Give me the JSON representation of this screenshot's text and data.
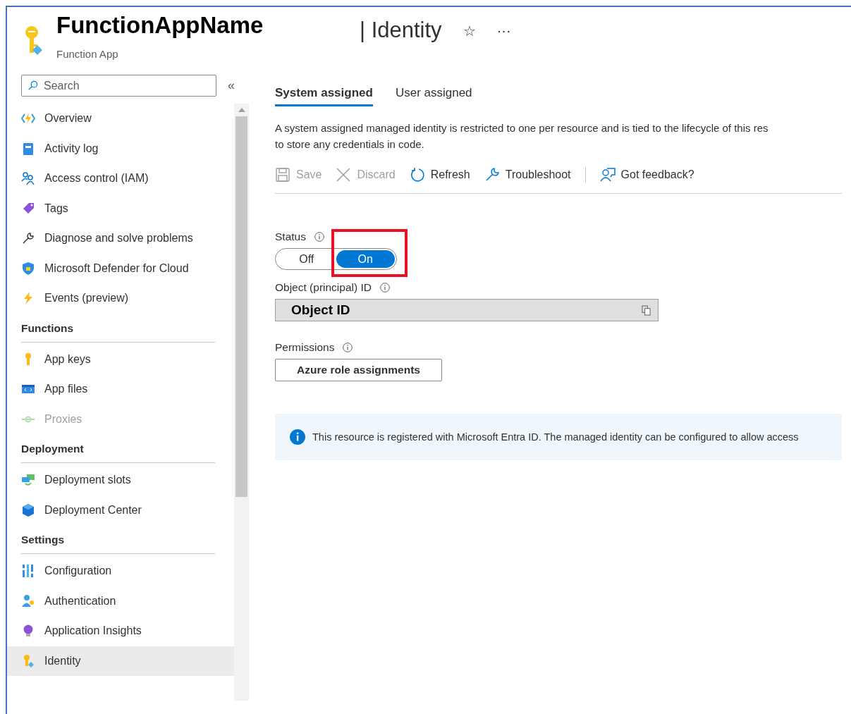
{
  "header": {
    "title": "FunctionAppName",
    "subtitle": "Function App",
    "page": "| Identity",
    "favorite": "☆",
    "more": "···"
  },
  "sidebar": {
    "search": {
      "placeholder": "Search"
    },
    "collapse": "«",
    "groups": [
      {
        "items": [
          {
            "label": "Overview",
            "disabled": false,
            "selected": false
          },
          {
            "label": "Activity log",
            "disabled": false,
            "selected": false
          },
          {
            "label": "Access control (IAM)",
            "disabled": false,
            "selected": false
          },
          {
            "label": "Tags",
            "disabled": false,
            "selected": false
          },
          {
            "label": "Diagnose and solve problems",
            "disabled": false,
            "selected": false
          },
          {
            "label": "Microsoft Defender for Cloud",
            "disabled": false,
            "selected": false
          },
          {
            "label": "Events (preview)",
            "disabled": false,
            "selected": false
          }
        ]
      },
      {
        "heading": "Functions",
        "items": [
          {
            "label": "App keys",
            "disabled": false,
            "selected": false
          },
          {
            "label": "App files",
            "disabled": false,
            "selected": false
          },
          {
            "label": "Proxies",
            "disabled": true,
            "selected": false
          }
        ]
      },
      {
        "heading": "Deployment",
        "items": [
          {
            "label": "Deployment slots",
            "disabled": false,
            "selected": false
          },
          {
            "label": "Deployment Center",
            "disabled": false,
            "selected": false
          }
        ]
      },
      {
        "heading": "Settings",
        "items": [
          {
            "label": "Configuration",
            "disabled": false,
            "selected": false
          },
          {
            "label": "Authentication",
            "disabled": false,
            "selected": false
          },
          {
            "label": "Application Insights",
            "disabled": false,
            "selected": false
          },
          {
            "label": "Identity",
            "disabled": false,
            "selected": true
          }
        ]
      }
    ]
  },
  "tabs": [
    {
      "label": "System assigned",
      "selected": true
    },
    {
      "label": "User assigned",
      "selected": false
    }
  ],
  "description": "A system assigned managed identity is restricted to one per resource and is tied to the lifecycle of this res\nto store any credentials in code.",
  "toolbar": {
    "actions": [
      {
        "label": "Save",
        "disabled": true
      },
      {
        "label": "Discard",
        "disabled": true
      },
      {
        "label": "Refresh",
        "disabled": false
      },
      {
        "label": "Troubleshoot",
        "disabled": false
      }
    ],
    "feedback": {
      "label": "Got feedback?",
      "disabled": false
    }
  },
  "status": {
    "label": "Status",
    "options": [
      {
        "label": "Off",
        "selected": false,
        "highlighted": false
      },
      {
        "label": "On",
        "selected": true,
        "highlighted": true
      }
    ]
  },
  "object_id": {
    "label": "Object (principal) ID",
    "value": "Object ID"
  },
  "permissions": {
    "label": "Permissions",
    "button": "Azure role assignments"
  },
  "info": "This resource is registered with Microsoft Entra ID. The managed identity can be configured to allow access"
}
